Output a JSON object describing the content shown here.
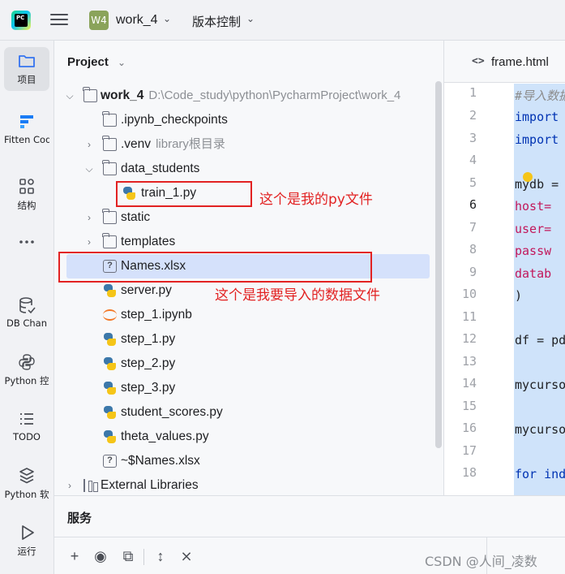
{
  "titlebar": {
    "app_logo_text": "PC",
    "project_badge": "W4",
    "project_name": "work_4",
    "vcs_label": "版本控制"
  },
  "toolstrip": [
    {
      "label": "项目",
      "icon": "folder-icon",
      "active": true
    },
    {
      "label": "Fitten Code",
      "icon": "fitten-icon"
    },
    {
      "label": "结构",
      "icon": "structure-icon"
    },
    {
      "label": "",
      "icon": "more-icon"
    },
    {
      "label": "DB Chan",
      "icon": "database-icon"
    },
    {
      "label": "Python 控",
      "icon": "python-console-icon"
    },
    {
      "label": "TODO",
      "icon": "todo-icon"
    },
    {
      "label": "Python 软",
      "icon": "python-packages-icon"
    },
    {
      "label": "运行",
      "icon": "run-icon"
    }
  ],
  "project_panel": {
    "title": "Project",
    "tree": [
      {
        "name": "work_4",
        "sub": "D:\\Code_study\\python\\PycharmProject\\work_4",
        "type": "folder",
        "depth": 0,
        "arrow": "down"
      },
      {
        "name": ".ipynb_checkpoints",
        "sub": "",
        "type": "folder",
        "depth": 1,
        "arrow": ""
      },
      {
        "name": ".venv",
        "sub": "library根目录",
        "type": "folder",
        "depth": 1,
        "arrow": "right"
      },
      {
        "name": "data_students",
        "sub": "",
        "type": "folder",
        "depth": 1,
        "arrow": "down"
      },
      {
        "name": "train_1.py",
        "sub": "",
        "type": "python",
        "depth": 2,
        "arrow": ""
      },
      {
        "name": "static",
        "sub": "",
        "type": "folder",
        "depth": 1,
        "arrow": "right"
      },
      {
        "name": "templates",
        "sub": "",
        "type": "folder",
        "depth": 1,
        "arrow": "right"
      },
      {
        "name": "Names.xlsx",
        "sub": "",
        "type": "unknown",
        "depth": 1,
        "arrow": "",
        "highlighted": true
      },
      {
        "name": "server.py",
        "sub": "",
        "type": "python",
        "depth": 1,
        "arrow": ""
      },
      {
        "name": "step_1.ipynb",
        "sub": "",
        "type": "notebook",
        "depth": 1,
        "arrow": ""
      },
      {
        "name": "step_1.py",
        "sub": "",
        "type": "python",
        "depth": 1,
        "arrow": ""
      },
      {
        "name": "step_2.py",
        "sub": "",
        "type": "python",
        "depth": 1,
        "arrow": ""
      },
      {
        "name": "step_3.py",
        "sub": "",
        "type": "python",
        "depth": 1,
        "arrow": ""
      },
      {
        "name": "student_scores.py",
        "sub": "",
        "type": "python",
        "depth": 1,
        "arrow": ""
      },
      {
        "name": "theta_values.py",
        "sub": "",
        "type": "python",
        "depth": 1,
        "arrow": ""
      },
      {
        "name": "~$Names.xlsx",
        "sub": "",
        "type": "unknown",
        "depth": 1,
        "arrow": ""
      },
      {
        "name": "External Libraries",
        "sub": "",
        "type": "library",
        "depth": 0,
        "arrow": "right"
      }
    ]
  },
  "annotations": {
    "py_file": "这个是我的py文件",
    "data_file": "这个是我要导入的数据文件"
  },
  "editor": {
    "tab_icon": "<>",
    "tab_label": "frame.html",
    "current_line": 6,
    "line_numbers": [
      1,
      2,
      3,
      4,
      5,
      6,
      7,
      8,
      9,
      10,
      11,
      12,
      13,
      14,
      15,
      16,
      17,
      18
    ],
    "code_lines": [
      {
        "line": 1,
        "text": "#导入数据",
        "kind": "comment"
      },
      {
        "line": 2,
        "text": "import",
        "kind": "keyword"
      },
      {
        "line": 3,
        "text": "import",
        "kind": "keyword"
      },
      {
        "line": 5,
        "text": "mydb =",
        "kind": "plain"
      },
      {
        "line": 6,
        "text": "  host=",
        "kind": "attr"
      },
      {
        "line": 7,
        "text": "  user=",
        "kind": "attr"
      },
      {
        "line": 8,
        "text": "  passw",
        "kind": "attr"
      },
      {
        "line": 9,
        "text": "  datab",
        "kind": "attr"
      },
      {
        "line": 10,
        "text": ")",
        "kind": "plain"
      },
      {
        "line": 12,
        "text": "df = pd",
        "kind": "plain"
      },
      {
        "line": 14,
        "text": "mycurso",
        "kind": "plain"
      },
      {
        "line": 16,
        "text": "mycurso",
        "kind": "plain"
      },
      {
        "line": 18,
        "text": "for ind",
        "kind": "keyword"
      }
    ]
  },
  "services": {
    "title": "服务"
  },
  "watermark": "CSDN @人间_凌数"
}
